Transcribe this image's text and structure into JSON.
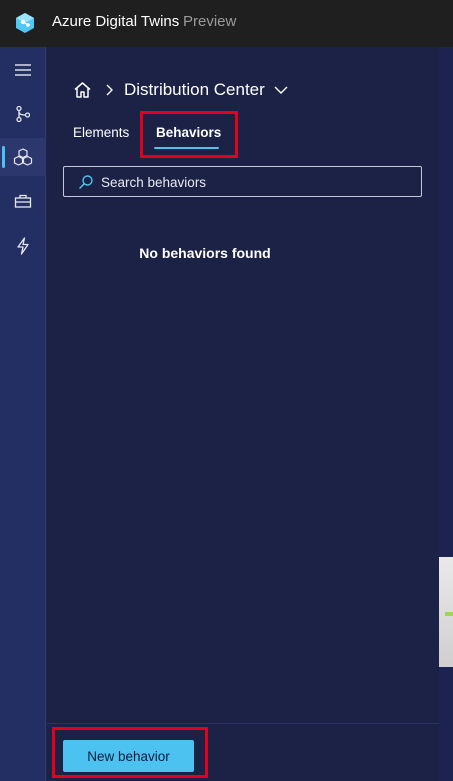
{
  "header": {
    "app_name": "Azure Digital Twins",
    "preview_label": "Preview",
    "logo_icon": "azure-digital-twins-logo"
  },
  "leftnav": {
    "items": [
      {
        "icon": "hamburger-menu-icon",
        "active": false
      },
      {
        "icon": "graph-branch-icon",
        "active": false
      },
      {
        "icon": "scene-cubes-icon",
        "active": true
      },
      {
        "icon": "toolbox-icon",
        "active": false
      },
      {
        "icon": "lightning-icon",
        "active": false
      }
    ]
  },
  "breadcrumb": {
    "home_icon": "home-icon",
    "separator_icon": "chevron-right-icon",
    "scene_name": "Distribution Center",
    "dropdown_icon": "chevron-down-icon"
  },
  "tabs": [
    {
      "label": "Elements",
      "selected": false
    },
    {
      "label": "Behaviors",
      "selected": true
    }
  ],
  "search": {
    "placeholder": "Search behaviors"
  },
  "empty_state": {
    "message": "No behaviors found"
  },
  "footer": {
    "new_behavior_label": "New behavior"
  },
  "colors": {
    "accent": "#4cc2f1",
    "highlight": "#e3001b",
    "panel_bg": "#1b2246",
    "nav_bg": "#232f63",
    "topbar_bg": "#1f1f1f"
  }
}
